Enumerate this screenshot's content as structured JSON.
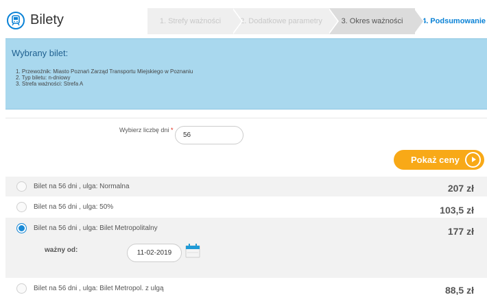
{
  "header": {
    "title": "Bilety",
    "steps": [
      {
        "label": "1. Strefy ważności"
      },
      {
        "label": "2. Dodatkowe parametry"
      },
      {
        "label": "3. Okres ważności"
      },
      {
        "label": "4. Podsumowanie"
      }
    ]
  },
  "info": {
    "title": "Wybrany bilet:",
    "items": [
      "1. Przewoźnik: Miasto Poznań Zarząd Transportu Miejskiego w Poznaniu",
      "2. Typ biletu: n-dniowy",
      "3. Strefa ważności: Strefa A"
    ]
  },
  "form": {
    "days_label": "Wybierz liczbę dni",
    "required_mark": "*",
    "days_value": "56",
    "show_button": "Pokaż ceny",
    "valid_from_label": "ważny od:",
    "valid_from_value": "11-02-2019"
  },
  "tickets": [
    {
      "label": "Bilet na 56 dni , ulga: Normalna",
      "price": "207 zł",
      "selected": false
    },
    {
      "label": "Bilet na 56 dni , ulga: 50%",
      "price": "103,5 zł",
      "selected": false
    },
    {
      "label": "Bilet na 56 dni , ulga: Bilet Metropolitalny",
      "price": "177 zł",
      "selected": true
    },
    {
      "label": "Bilet na 56 dni , ulga: Bilet Metropol. z ulgą",
      "price": "88,5 zł",
      "selected": false
    }
  ],
  "icons": {
    "logo": "train-icon",
    "calendar": "calendar-icon",
    "button": "arrow-right-icon"
  },
  "colors": {
    "brand": "#0a82d6",
    "accent": "#f8a917",
    "info_bg": "#a9d8ee"
  }
}
